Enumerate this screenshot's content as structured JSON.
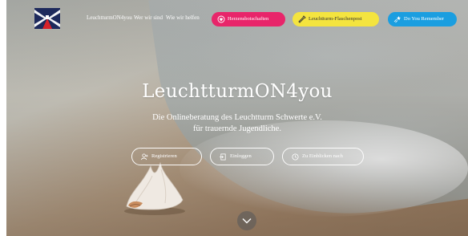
{
  "header": {
    "nav": [
      "LeuchtturmON4you",
      "Wer wir sind",
      "Wie wir helfen"
    ],
    "pills": [
      {
        "label": "Herzensbotschaften",
        "icon": "heart-circle-icon",
        "color": "#e8256a"
      },
      {
        "label": "Leuchtturm-Flaschenpost",
        "icon": "bottle-icon",
        "color": "#f4e43f"
      },
      {
        "label": "Do You Remember",
        "icon": "shooting-star-icon",
        "color": "#1b9ee0"
      }
    ]
  },
  "hero": {
    "title": "LeuchtturmON4you",
    "subtitle_line1": "Die Onlineberatung des Leuchtturm Schwerte e.V.",
    "subtitle_line2": "für trauernde Jugendliche.",
    "buttons": [
      {
        "label": "Registrieren",
        "icon": "person-plus-icon"
      },
      {
        "label": "Einloggen",
        "icon": "login-icon"
      },
      {
        "label": "Zu Einblicken nach",
        "icon": "clock-icon"
      }
    ],
    "scroll_icon": "chevron-down-icon"
  },
  "colors": {
    "accent_red": "#e8256a",
    "accent_yellow": "#f4e43f",
    "accent_blue": "#1b9ee0"
  }
}
